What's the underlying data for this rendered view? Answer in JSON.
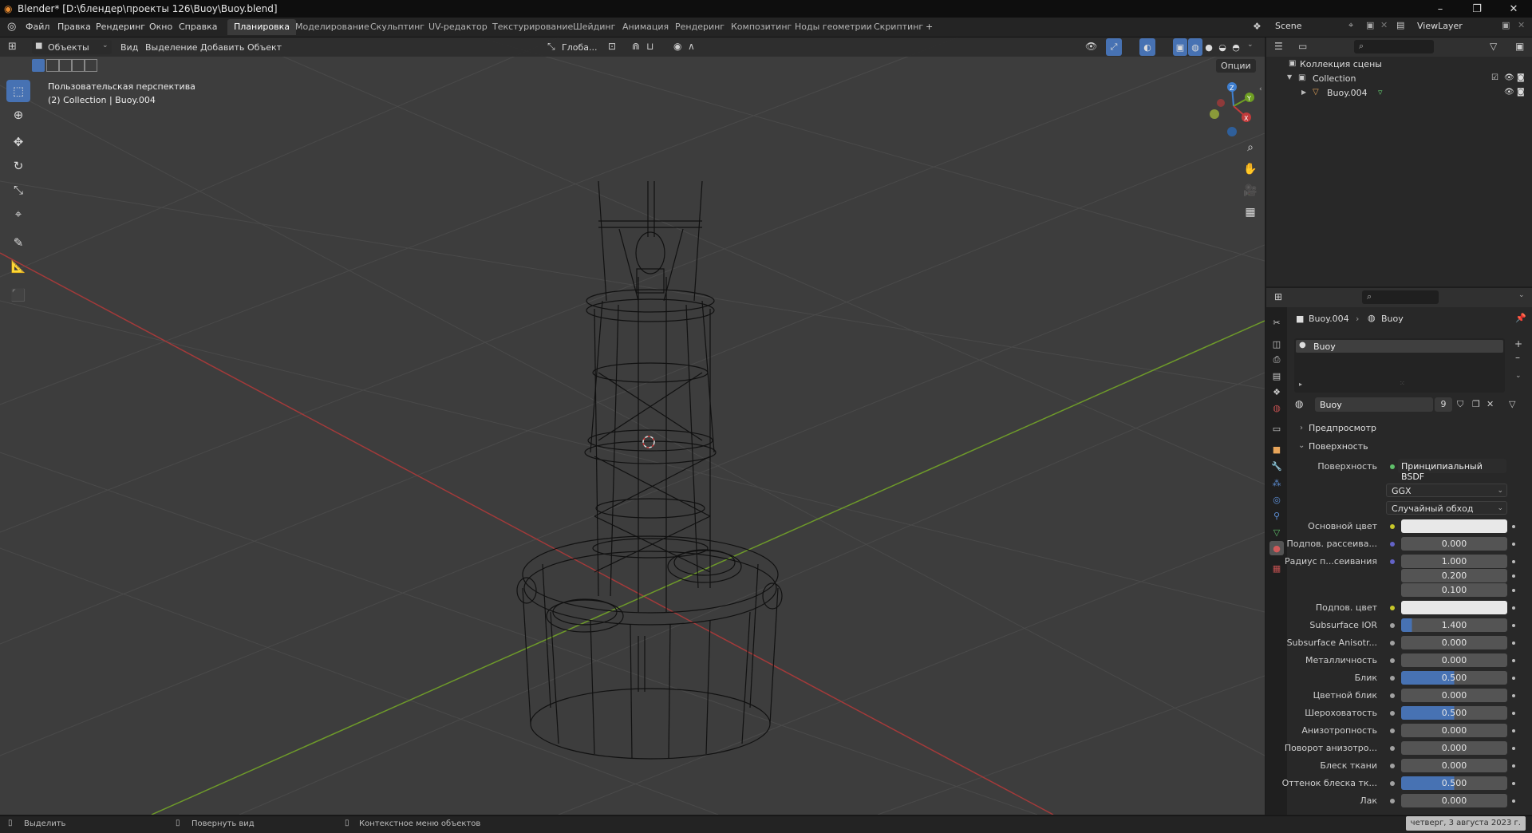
{
  "window": {
    "title": "Blender* [D:\\блендер\\проекты 126\\Buoy\\Buoy.blend]"
  },
  "menus": [
    "Файл",
    "Правка",
    "Рендеринг",
    "Окно",
    "Справка"
  ],
  "workspaces": [
    {
      "label": "Планировка",
      "active": true
    },
    {
      "label": "Моделирование"
    },
    {
      "label": "Скульптинг"
    },
    {
      "label": "UV-редактор"
    },
    {
      "label": "Текстурирование"
    },
    {
      "label": "Шейдинг"
    },
    {
      "label": "Анимация"
    },
    {
      "label": "Рендеринг"
    },
    {
      "label": "Композитинг"
    },
    {
      "label": "Ноды геометрии"
    },
    {
      "label": "Скриптинг"
    }
  ],
  "scene": {
    "name": "Scene",
    "view_layer": "ViewLayer"
  },
  "viewport_header": {
    "mode": "Объекты",
    "menus": [
      "Вид",
      "Выделение",
      "Добавить",
      "Объект"
    ],
    "orientation": "Глоба...",
    "options": "Опции"
  },
  "viewport": {
    "perspective": "Пользовательская перспектива",
    "context": "(2) Collection | Buoy.004"
  },
  "outliner": {
    "root": "Коллекция сцены",
    "collection": "Collection",
    "object": "Buoy.004"
  },
  "properties": {
    "breadcrumb_object": "Buoy.004",
    "breadcrumb_material": "Buoy",
    "slot_name": "Buoy",
    "material_name": "Buoy",
    "user_count": "9",
    "sections": {
      "preview": "Предпросмотр",
      "surface": "Поверхность"
    },
    "surface_label": "Поверхность",
    "surface_shader": "Принципиальный BSDF",
    "distribution": "GGX",
    "subsurface_method": "Случайный обход",
    "fields": [
      {
        "label": "Основной цвет",
        "type": "color",
        "value": "",
        "socket": "#c7c729"
      },
      {
        "label": "Подпов. рассеива...",
        "type": "num",
        "value": "0.000",
        "socket": "#6363c7",
        "fill": 0
      },
      {
        "label": "Радиус п...сеивания",
        "type": "num",
        "value": "1.000",
        "socket": "#6363c7",
        "fill": 0
      },
      {
        "label": "",
        "type": "num",
        "value": "0.200",
        "fill": 0
      },
      {
        "label": "",
        "type": "num",
        "value": "0.100",
        "fill": 0
      },
      {
        "label": "Подпов. цвет",
        "type": "color",
        "value": "",
        "socket": "#c7c729"
      },
      {
        "label": "Subsurface IOR",
        "type": "num",
        "value": "1.400",
        "socket": "#a1a1a1",
        "fill": 0.1
      },
      {
        "label": "Subsurface Anisotr...",
        "type": "num",
        "value": "0.000",
        "socket": "#a1a1a1",
        "fill": 0
      },
      {
        "label": "Металличность",
        "type": "num",
        "value": "0.000",
        "socket": "#a1a1a1",
        "fill": 0
      },
      {
        "label": "Блик",
        "type": "num",
        "value": "0.500",
        "socket": "#a1a1a1",
        "fill": 0.5
      },
      {
        "label": "Цветной блик",
        "type": "num",
        "value": "0.000",
        "socket": "#a1a1a1",
        "fill": 0
      },
      {
        "label": "Шероховатость",
        "type": "num",
        "value": "0.500",
        "socket": "#a1a1a1",
        "fill": 0.5
      },
      {
        "label": "Анизотропность",
        "type": "num",
        "value": "0.000",
        "socket": "#a1a1a1",
        "fill": 0
      },
      {
        "label": "Поворот анизотро...",
        "type": "num",
        "value": "0.000",
        "socket": "#a1a1a1",
        "fill": 0
      },
      {
        "label": "Блеск ткани",
        "type": "num",
        "value": "0.000",
        "socket": "#a1a1a1",
        "fill": 0
      },
      {
        "label": "Оттенок блеска тк...",
        "type": "num",
        "value": "0.500",
        "socket": "#a1a1a1",
        "fill": 0.5
      },
      {
        "label": "Лак",
        "type": "num",
        "value": "0.000",
        "socket": "#a1a1a1",
        "fill": 0
      }
    ]
  },
  "statusbar": {
    "select": "Выделить",
    "rotate": "Повернуть вид",
    "context_menu": "Контекстное меню объектов",
    "datetime": "четверг, 3 августа 2023 г."
  },
  "colors": {
    "accent": "#4772b3",
    "x_axis": "#c23b3b",
    "y_axis": "#6f9f23",
    "z_axis": "#3f7fd0"
  }
}
